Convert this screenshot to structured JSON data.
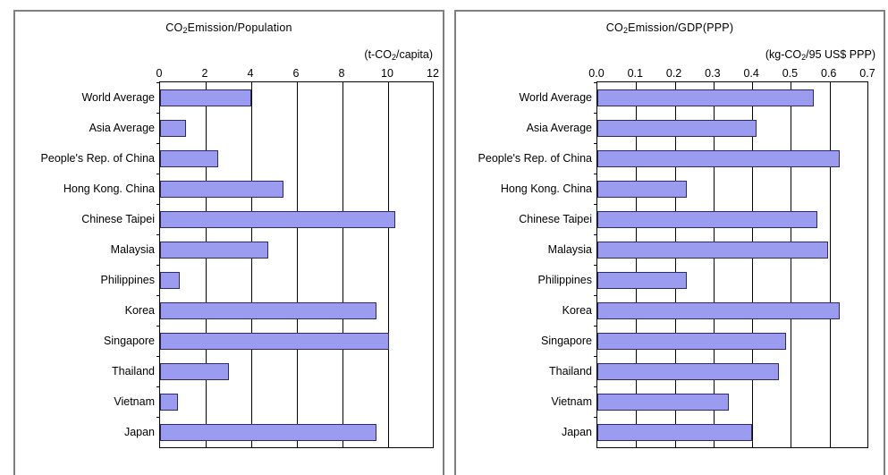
{
  "figure": {
    "panels": [
      {
        "id": "co2-per-population",
        "title_html": "CO<sub>2</sub>Emission/Population",
        "title_text": "CO2Emission/Population",
        "unit_html": "(t-CO<sub>2</sub>/capita)",
        "unit_text": "(t-CO2/capita)"
      },
      {
        "id": "co2-per-gdp-ppp",
        "title_html": "CO<sub>2</sub>Emission/GDP(PPP)",
        "title_text": "CO2Emission/GDP(PPP)",
        "unit_html": "(kg-CO<sub>2</sub>/95 US$ PPP)",
        "unit_text": "(kg-CO2/95 US$ PPP)"
      }
    ],
    "bar_fill_color": "#9b9bf0",
    "bar_border_color": "#2b2b6b",
    "frame_color": "#808080",
    "axis_color": "#000000"
  },
  "chart_data": [
    {
      "type": "bar",
      "orientation": "horizontal",
      "title": "CO2Emission/Population",
      "xlabel": "(t-CO2/capita)",
      "ylabel": "",
      "xlim": [
        0,
        12
      ],
      "xticks": [
        "0",
        "2",
        "4",
        "6",
        "8",
        "10",
        "12"
      ],
      "xtick_values": [
        0,
        2,
        4,
        6,
        8,
        10,
        12
      ],
      "grid": true,
      "legend": false,
      "categories": [
        "World   Average",
        "Asia Average",
        "People's Rep. of China",
        "Hong Kong. China",
        "Chinese Taipei",
        "Malaysia",
        "Philippines",
        "Korea",
        "Singapore",
        "Thailand",
        "Vietnam",
        "Japan"
      ],
      "values": [
        4.0,
        1.15,
        2.55,
        5.4,
        10.3,
        4.75,
        0.85,
        9.5,
        10.05,
        3.0,
        0.8,
        9.5
      ]
    },
    {
      "type": "bar",
      "orientation": "horizontal",
      "title": "CO2Emission/GDP(PPP)",
      "xlabel": "(kg-CO2/95 US$ PPP)",
      "ylabel": "",
      "xlim": [
        0,
        0.7
      ],
      "xticks": [
        "0.0",
        "0.1",
        "0.2",
        "0.3",
        "0.4",
        "0.5",
        "0.6",
        "0.7"
      ],
      "xtick_values": [
        0.0,
        0.1,
        0.2,
        0.3,
        0.4,
        0.5,
        0.6,
        0.7
      ],
      "grid": true,
      "legend": false,
      "categories": [
        "World   Average",
        "Asia Average",
        "People's Rep. of China",
        "Hong Kong. China",
        "Chinese Taipei",
        "Malaysia",
        "Philippines",
        "Korea",
        "Singapore",
        "Thailand",
        "Vietnam",
        "Japan"
      ],
      "values": [
        0.558,
        0.412,
        0.626,
        0.231,
        0.568,
        0.597,
        0.231,
        0.626,
        0.487,
        0.47,
        0.339,
        0.399
      ]
    }
  ]
}
